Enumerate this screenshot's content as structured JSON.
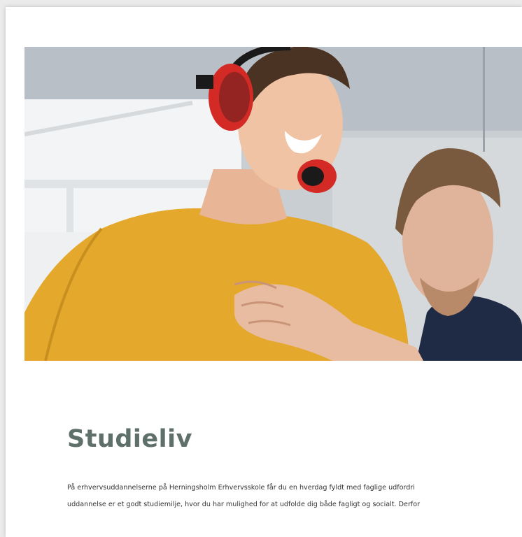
{
  "section": {
    "title": "Studieliv",
    "paragraph_lines": [
      "På erhvervsuddannelserne på Herningsholm Erhvervsskole får du en hverdag fyldt med faglige udfordri",
      "uddannelse er et godt studiemilje, hvor du har mulighed for at udfolde dig både fagligt og socialt. Derfor"
    ]
  },
  "hero_image": {
    "subject": "two-young-men-one-wearing-red-ear-protection-and-yellow-sweater"
  },
  "colors": {
    "title": "#5f6f69",
    "sweater": "#e4a82c",
    "earmuffs": "#d42a25",
    "dark_jacket": "#1f2a44"
  }
}
